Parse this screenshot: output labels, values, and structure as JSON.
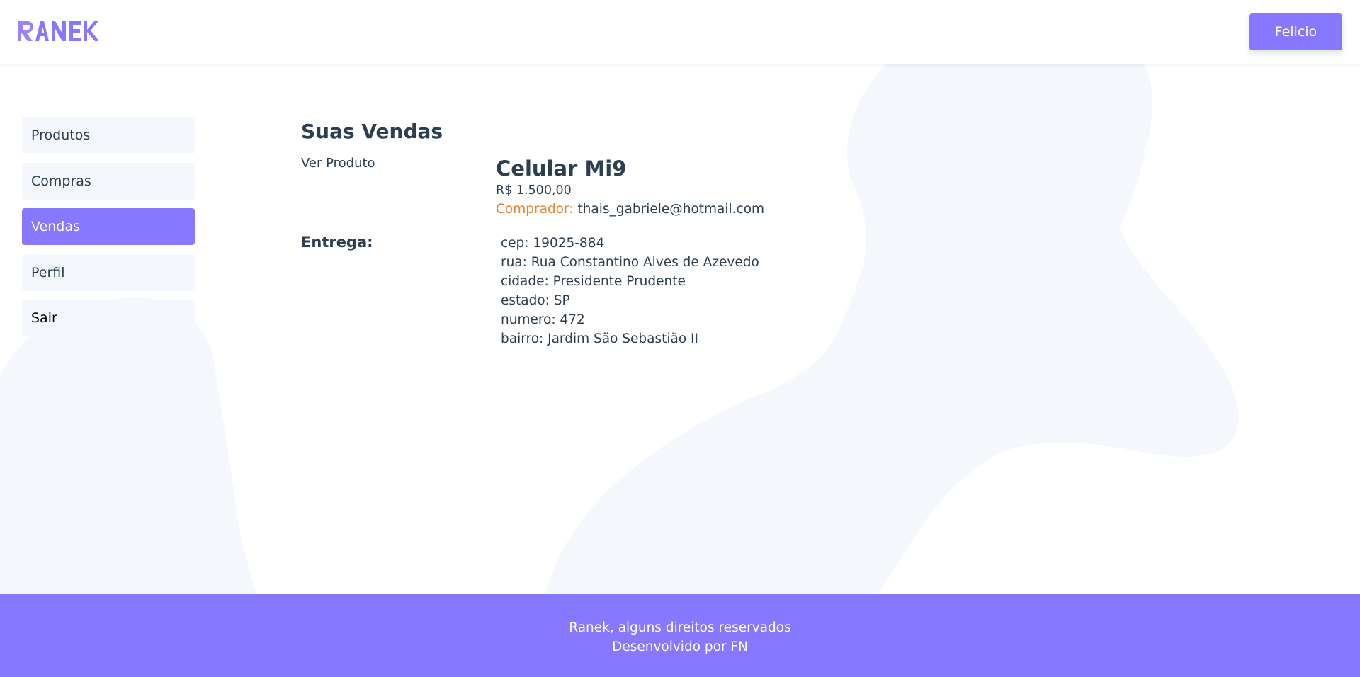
{
  "header": {
    "logo": "RANEK",
    "user_button": "Felicio"
  },
  "sidebar": {
    "items": [
      {
        "label": "Produtos"
      },
      {
        "label": "Compras"
      },
      {
        "label": "Vendas",
        "active": true
      },
      {
        "label": "Perfil"
      },
      {
        "label": "Sair"
      }
    ]
  },
  "main": {
    "title": "Suas Vendas",
    "sale": {
      "link": "Ver Produto",
      "product_name": "Celular Mi9",
      "price": "R$ 1.500,00",
      "buyer_label": "Comprador:",
      "buyer_email": "thais_gabriele@hotmail.com"
    },
    "delivery": {
      "label": "Entrega:",
      "lines": [
        "cep: 19025-884",
        "rua: Rua Constantino Alves de Azevedo",
        "cidade: Presidente Prudente",
        "estado: SP",
        "numero: 472",
        "bairro: Jardim São Sebastião II"
      ]
    }
  },
  "footer": {
    "line1": "Ranek, alguns direitos reservados",
    "line2": "Desenvolvido por FN"
  },
  "colors": {
    "accent": "#8877ff",
    "text": "#2c3e50",
    "buyer_label": "#e8822e",
    "sidebar_bg": "#f4f7fc",
    "blob": "#f4f7fc"
  }
}
